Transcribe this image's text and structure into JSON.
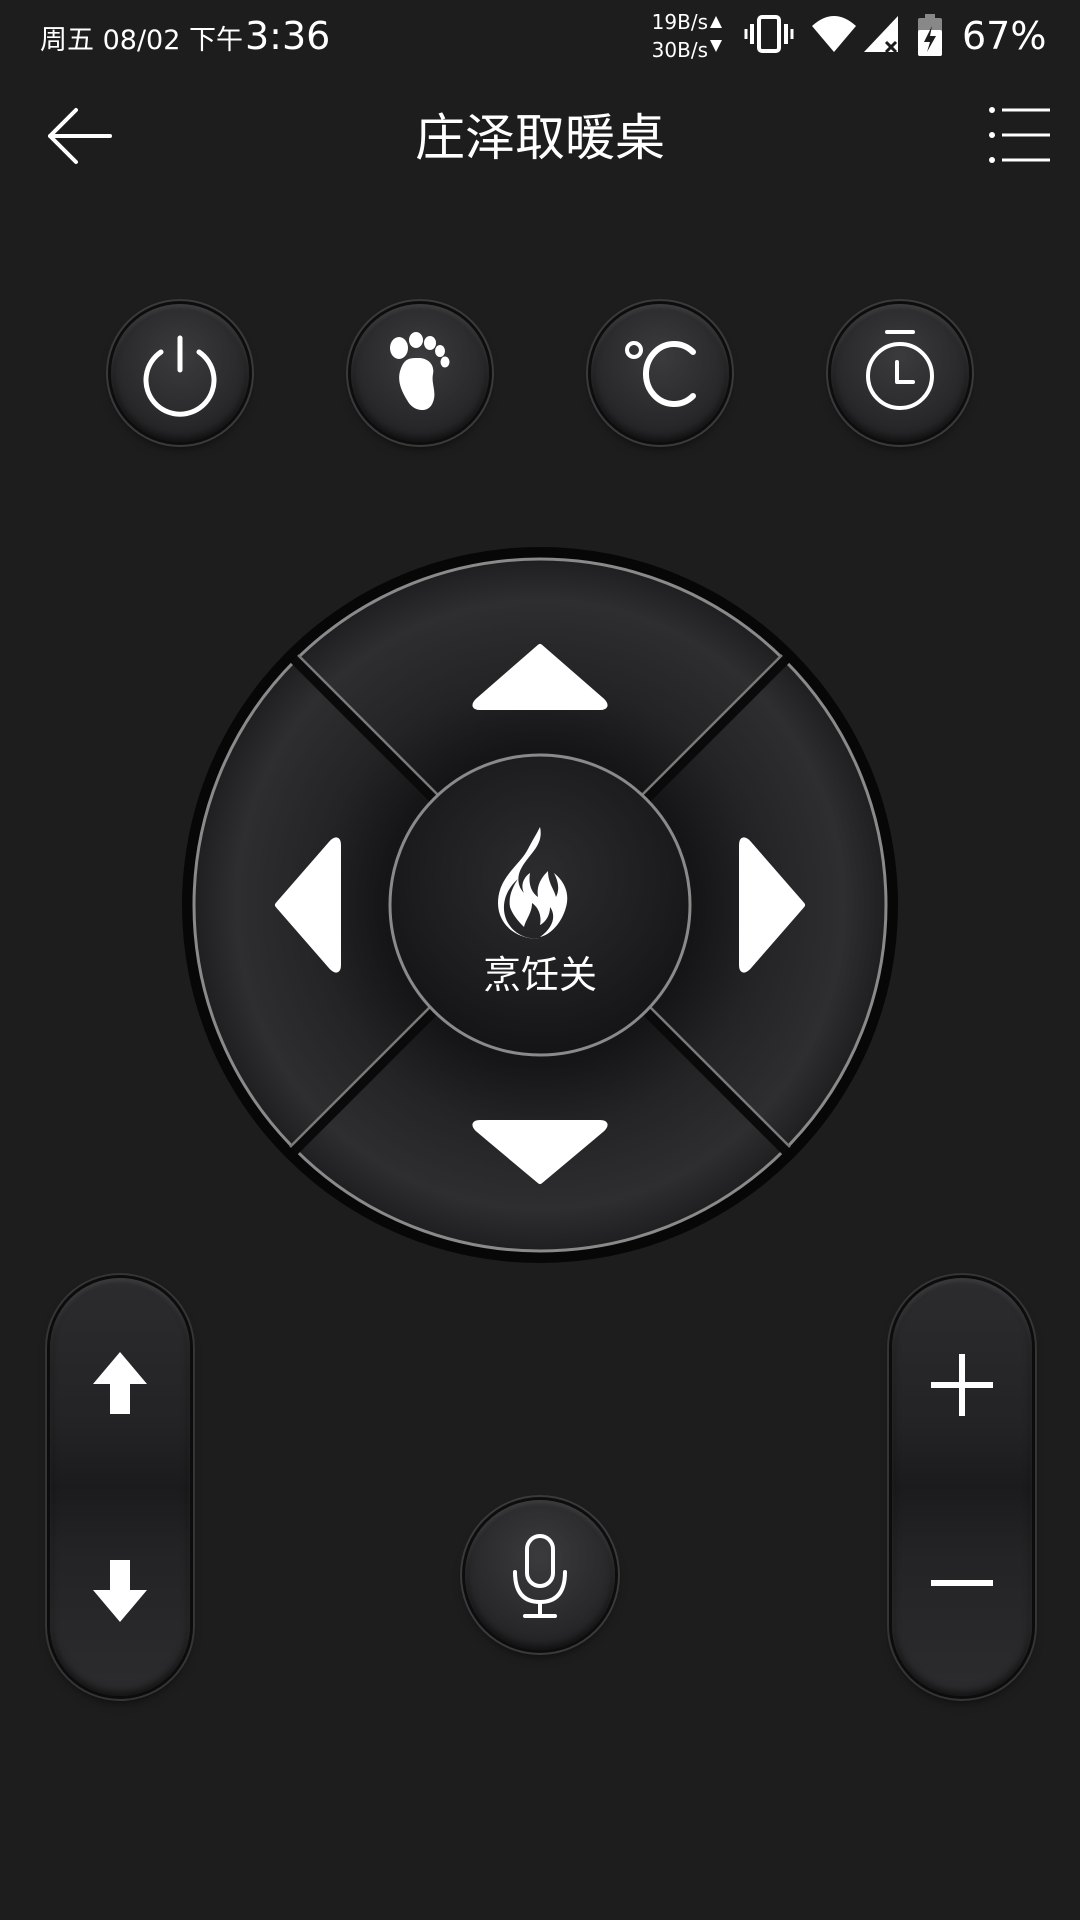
{
  "status_bar": {
    "date": "周五 08/02",
    "period": "下午",
    "time": "3:36",
    "upload_speed": "19B/s",
    "download_speed": "30B/s",
    "battery": "67%",
    "icons": [
      "vibrate-icon",
      "wifi-icon",
      "cell-signal-icon",
      "battery-charging-icon"
    ]
  },
  "header": {
    "title": "庄泽取暖桌",
    "back_icon": "arrow-left-icon",
    "menu_icon": "list-menu-icon"
  },
  "top_buttons": [
    {
      "name": "power",
      "icon": "power-icon"
    },
    {
      "name": "foot-warmer",
      "icon": "footprint-icon"
    },
    {
      "name": "temperature",
      "icon": "celsius-icon"
    },
    {
      "name": "timer",
      "icon": "timer-icon"
    }
  ],
  "dpad": {
    "center_label": "烹饪关",
    "center_icon": "flame-icon",
    "directions": [
      "up",
      "down",
      "left",
      "right"
    ]
  },
  "left_pill": {
    "icons": [
      "arrow-up-icon",
      "arrow-down-icon"
    ]
  },
  "right_pill": {
    "icons": [
      "plus-icon",
      "minus-icon"
    ]
  },
  "voice": {
    "icon": "microphone-icon"
  },
  "colors": {
    "background": "#1d1d1d",
    "button_face": "#2a2a2c",
    "foreground": "#ffffff"
  }
}
